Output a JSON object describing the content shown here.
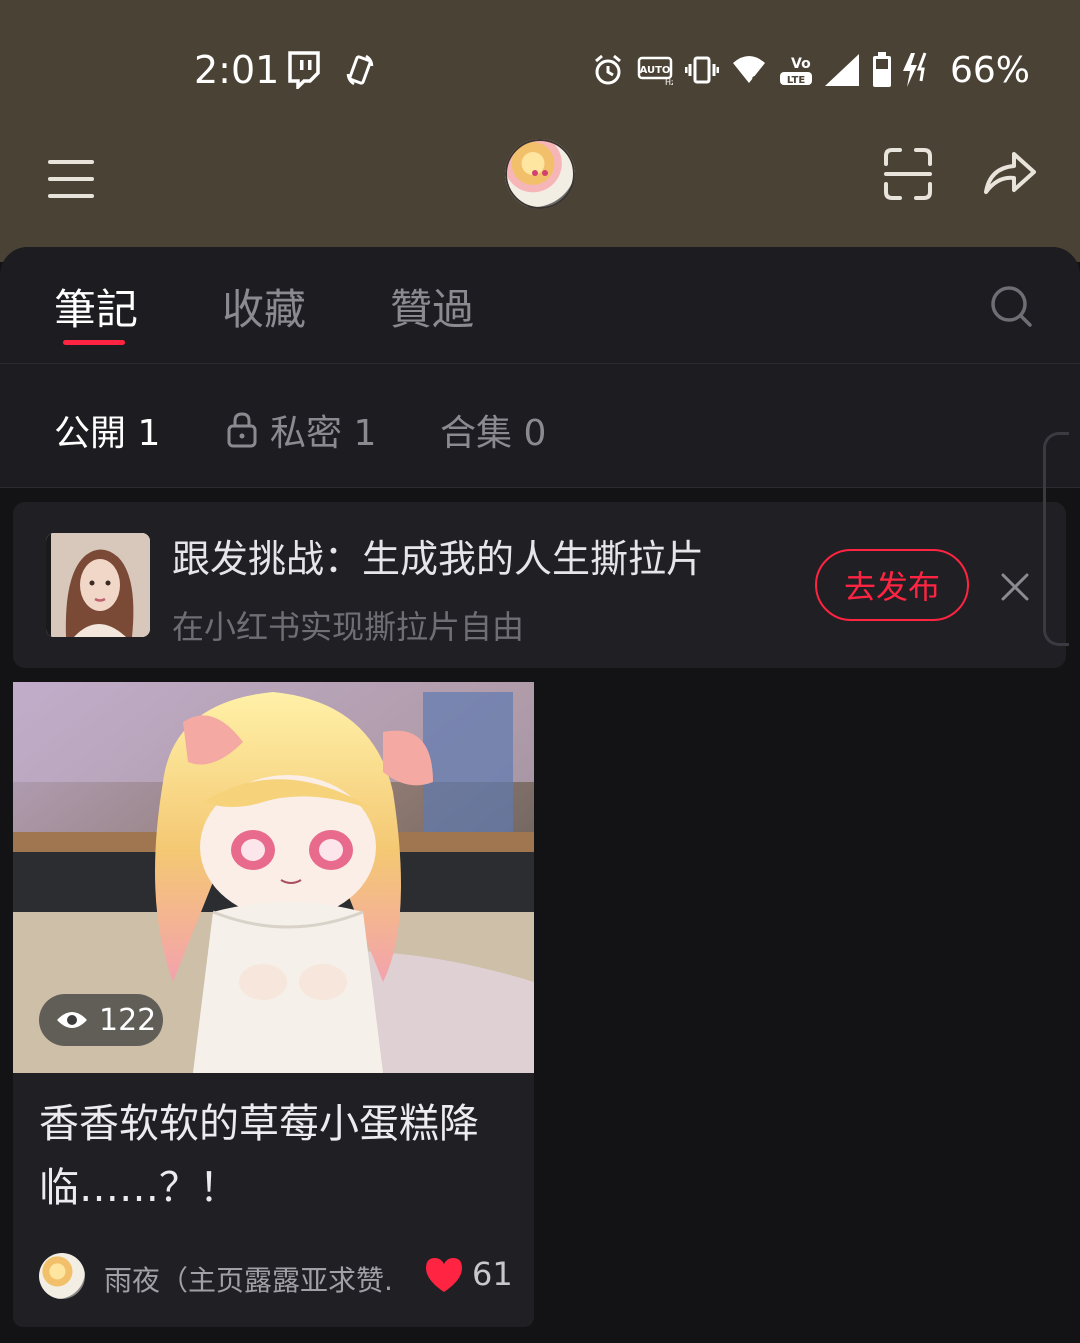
{
  "status_bar": {
    "time": "2:01",
    "battery": "66%",
    "icons": [
      "twitch-icon",
      "rotate-icon",
      "alarm-icon",
      "auto-hz-icon",
      "vibrate-icon",
      "wifi-icon",
      "volte-icon",
      "signal-icon",
      "battery-icon",
      "charging-icon"
    ]
  },
  "header": {
    "icons": [
      "menu-icon",
      "profile-avatar",
      "scan-icon",
      "share-icon"
    ]
  },
  "tabs": {
    "items": [
      {
        "label": "筆記"
      },
      {
        "label": "收藏"
      },
      {
        "label": "贊過"
      }
    ],
    "active_index": 0,
    "search_icon": "search-icon"
  },
  "subtabs": {
    "public": "公開 1",
    "private": "私密 1",
    "collections": "合集 0"
  },
  "banner": {
    "title": "跟发挑战：生成我的人生撕拉片",
    "subtitle": "在小红书实现撕拉片自由",
    "button": "去发布"
  },
  "note_card": {
    "views": "122",
    "title": "香香软软的草莓小蛋糕降临……？！",
    "author": "雨夜（主页露露亚求赞...",
    "likes": "61"
  },
  "colors": {
    "header_bg": "#4a4234",
    "page_bg": "#131316",
    "accent": "#ff2442"
  }
}
